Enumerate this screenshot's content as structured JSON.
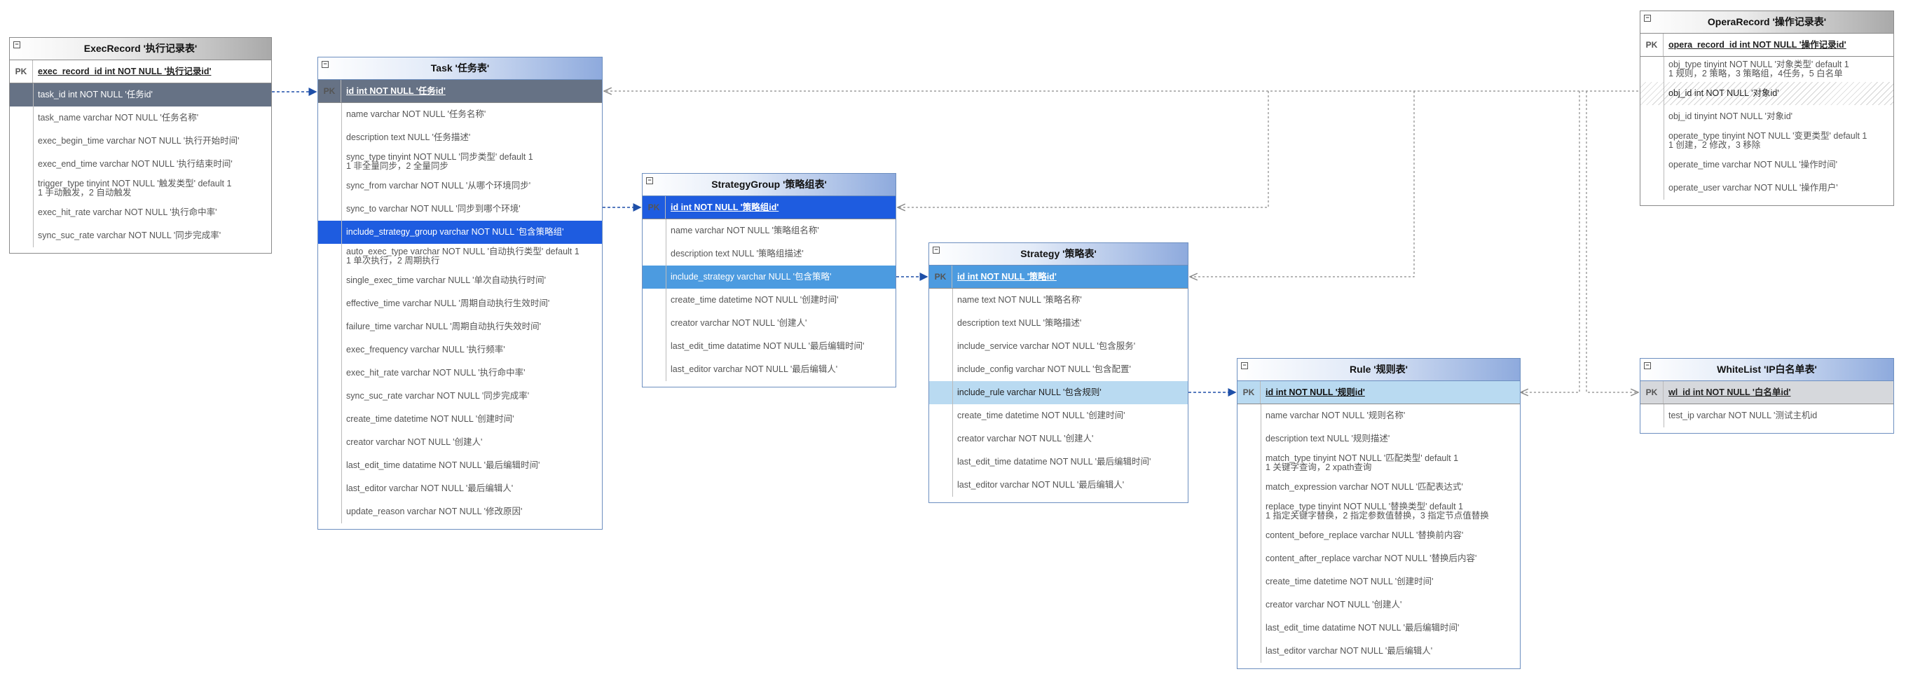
{
  "tables": [
    {
      "id": "execrecord",
      "title": "ExecRecord '执行记录表'",
      "style": "gray",
      "fields": [
        {
          "text": "exec_record_id int NOT NULL '执行记录id'",
          "pk": true
        },
        {
          "text": "task_id int NOT NULL '任务id'",
          "hl": "dark"
        },
        {
          "text": "task_name varchar NOT NULL '任务名称'"
        },
        {
          "text": "exec_begin_time varchar NOT NULL '执行开始时间'"
        },
        {
          "text": "exec_end_time varchar NOT NULL '执行结束时间'"
        },
        {
          "text": "trigger_type tinyint NOT NULL '触发类型' default 1\n1 手动触发，2 自动触发"
        },
        {
          "text": "exec_hit_rate varchar NOT NULL '执行命中率'"
        },
        {
          "text": "sync_suc_rate varchar NOT NULL '同步完成率'"
        }
      ]
    },
    {
      "id": "task",
      "title": "Task '任务表'",
      "style": "blue",
      "fields": [
        {
          "text": "id int NOT NULL '任务id'",
          "pk": true,
          "hl": "dark"
        },
        {
          "text": "name varchar NOT NULL '任务名称'"
        },
        {
          "text": "description text NULL '任务描述'"
        },
        {
          "text": "sync_type tinyint NOT NULL '同步类型' default 1\n1 非全量同步，2 全量同步"
        },
        {
          "text": "sync_from varchar NOT NULL '从哪个环境同步'"
        },
        {
          "text": "sync_to varchar NOT NULL '同步到哪个环境'"
        },
        {
          "text": "include_strategy_group varchar NOT NULL '包含策略组'",
          "hl": "blue"
        },
        {
          "text": "auto_exec_type varchar NOT NULL '自动执行类型' default 1\n1 单次执行，2 周期执行"
        },
        {
          "text": "single_exec_time varchar NULL '单次自动执行时间'"
        },
        {
          "text": "effective_time varchar NULL '周期自动执行生效时间'"
        },
        {
          "text": "failure_time varchar NULL '周期自动执行失效时间'"
        },
        {
          "text": "exec_frequency varchar NULL '执行频率'"
        },
        {
          "text": "exec_hit_rate varchar NOT NULL '执行命中率'"
        },
        {
          "text": "sync_suc_rate varchar NOT NULL '同步完成率'"
        },
        {
          "text": "create_time datetime NOT NULL '创建时间'"
        },
        {
          "text": "creator varchar NOT NULL '创建人'"
        },
        {
          "text": "last_edit_time datatime NOT NULL '最后编辑时间'"
        },
        {
          "text": "last_editor varchar NOT NULL '最后编辑人'"
        },
        {
          "text": "update_reason varchar NOT NULL '修改原因'"
        }
      ]
    },
    {
      "id": "strategygroup",
      "title": "StrategyGroup '策略组表'",
      "style": "blue",
      "fields": [
        {
          "text": "id int NOT NULL '策略组id'",
          "pk": true,
          "hl": "blue"
        },
        {
          "text": "name varchar NOT NULL '策略组名称'"
        },
        {
          "text": "description text NULL '策略组描述'"
        },
        {
          "text": "include_strategy varchar NULL '包含策略'",
          "hl": "mid"
        },
        {
          "text": "create_time datetime NOT NULL '创建时间'"
        },
        {
          "text": "creator varchar NOT NULL '创建人'"
        },
        {
          "text": "last_edit_time datatime NOT NULL '最后编辑时间'"
        },
        {
          "text": "last_editor varchar NOT NULL '最后编辑人'"
        }
      ]
    },
    {
      "id": "strategy",
      "title": "Strategy '策略表'",
      "style": "blue",
      "fields": [
        {
          "text": "id int NOT NULL '策略id'",
          "pk": true,
          "hl": "mid"
        },
        {
          "text": "name text NOT NULL '策略名称'"
        },
        {
          "text": "description text NULL '策略描述'"
        },
        {
          "text": "include_service varchar NOT NULL '包含服务'"
        },
        {
          "text": "include_config varchar NOT NULL '包含配置'"
        },
        {
          "text": "include_rule varchar NULL '包含规则'",
          "hl": "light"
        },
        {
          "text": "create_time datetime NOT NULL '创建时间'"
        },
        {
          "text": "creator varchar NOT NULL '创建人'"
        },
        {
          "text": "last_edit_time datatime NOT NULL '最后编辑时间'"
        },
        {
          "text": "last_editor varchar NOT NULL '最后编辑人'"
        }
      ]
    },
    {
      "id": "rule",
      "title": "Rule '规则表'",
      "style": "blue",
      "fields": [
        {
          "text": "id int NOT NULL '规则id'",
          "pk": true,
          "hl": "light"
        },
        {
          "text": "name varchar NOT NULL '规则名称'"
        },
        {
          "text": "description text NULL '规则描述'"
        },
        {
          "text": "match_type tinyint NOT NULL '匹配类型' default 1\n1 关键字查询，2 xpath查询"
        },
        {
          "text": "match_expression varchar NOT NULL '匹配表达式'"
        },
        {
          "text": "replace_type tinyint NOT NULL '替换类型' default 1\n1 指定关键字替换，2 指定参数值替换，3 指定节点值替换"
        },
        {
          "text": "content_before_replace varchar NULL '替换前内容'"
        },
        {
          "text": "content_after_replace varchar NOT NULL '替换后内容'"
        },
        {
          "text": "create_time datetime NOT NULL '创建时间'"
        },
        {
          "text": "creator varchar NOT NULL '创建人'"
        },
        {
          "text": "last_edit_time datatime NOT NULL '最后编辑时间'"
        },
        {
          "text": "last_editor varchar NOT NULL '最后编辑人'"
        }
      ]
    },
    {
      "id": "operarecord",
      "title": "OperaRecord '操作记录表'",
      "style": "gray",
      "fields": [
        {
          "text": "opera_record_id int NOT NULL '操作记录id'",
          "pk": true
        },
        {
          "text": "obj_type tinyint NOT NULL '对象类型' default 1\n1 规则，2 策略，3 策略组，4任务，5 白名单"
        },
        {
          "text": "obj_id int NOT NULL '对象id'",
          "hl": "hatch"
        },
        {
          "text": "obj_id tinyint NOT NULL '对象id'"
        },
        {
          "text": "operate_type tinyint NOT NULL '变更类型' default 1\n1 创建，2 修改，3 移除"
        },
        {
          "text": "operate_time varchar NOT NULL '操作时间'"
        },
        {
          "text": "operate_user varchar NOT NULL '操作用户'"
        }
      ]
    },
    {
      "id": "whitelist",
      "title": "WhiteList 'IP白名单表'",
      "style": "blue",
      "fields": [
        {
          "text": "wl_id int NOT NULL '白名单id'",
          "pk": true,
          "hl": "graypk"
        },
        {
          "text": "test_ip varchar NOT NULL '测试主机id"
        }
      ]
    }
  ],
  "pk_label": "PK",
  "colors": {
    "connector": "#1e4fa8",
    "connector_gray": "#8a8a8a",
    "header_blue": "#8eaadd",
    "header_gray": "#a9a9a9"
  }
}
